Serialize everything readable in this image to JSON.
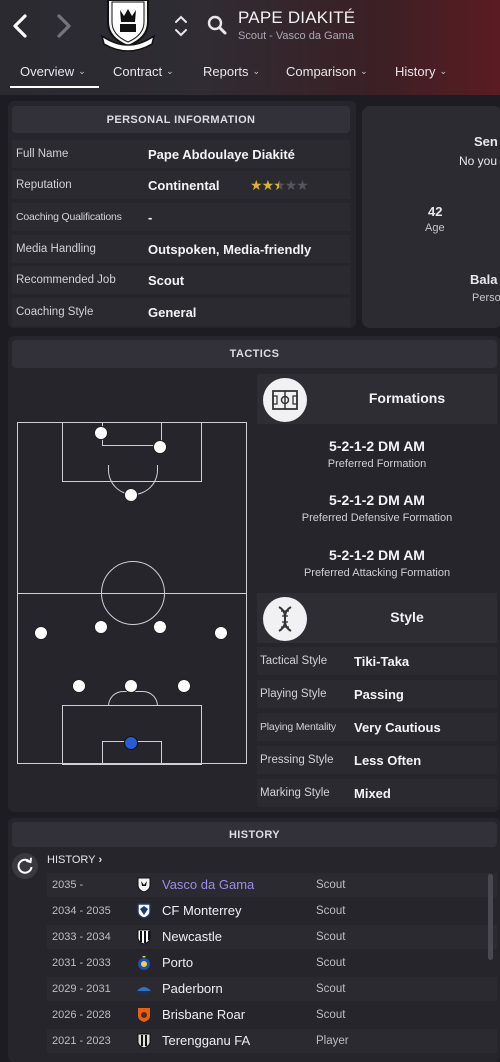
{
  "header": {
    "player_name": "PAPE DIAKITÉ",
    "subtitle": "Scout - Vasco da Gama"
  },
  "tabs": [
    {
      "label": "Overview",
      "active": true
    },
    {
      "label": "Contract"
    },
    {
      "label": "Reports"
    },
    {
      "label": "Comparison"
    },
    {
      "label": "History"
    }
  ],
  "personal": {
    "heading": "PERSONAL INFORMATION",
    "rows": [
      {
        "label": "Full Name",
        "value": "Pape Abdoulaye Diakité"
      },
      {
        "label": "Reputation",
        "value": "Continental",
        "stars": 2.5,
        "stars_max": 5
      },
      {
        "label": "Coaching Qualifications",
        "value": "-"
      },
      {
        "label": "Media Handling",
        "value": "Outspoken, Media-friendly"
      },
      {
        "label": "Recommended Job",
        "value": "Scout"
      },
      {
        "label": "Coaching Style",
        "value": "General"
      }
    ]
  },
  "side_card": {
    "line1": "Sen",
    "line2": "No you",
    "age_value": "42",
    "age_label": "Age",
    "line3": "Bala",
    "line4": "Perso"
  },
  "tactics": {
    "heading": "TACTICS",
    "formations_title": "Formations",
    "formations": [
      {
        "value": "5-2-1-2 DM AM",
        "label": "Preferred Formation"
      },
      {
        "value": "5-2-1-2 DM AM",
        "label": "Preferred Defensive Formation"
      },
      {
        "value": "5-2-1-2 DM AM",
        "label": "Preferred Attacking Formation"
      }
    ],
    "style_title": "Style",
    "style_rows": [
      {
        "label": "Tactical Style",
        "value": "Tiki-Taka"
      },
      {
        "label": "Playing Style",
        "value": "Passing"
      },
      {
        "label": "Playing Mentality",
        "value": "Very Cautious"
      },
      {
        "label": "Pressing Style",
        "value": "Less Often"
      },
      {
        "label": "Marking Style",
        "value": "Mixed"
      }
    ]
  },
  "history": {
    "heading": "HISTORY",
    "link_label": "HISTORY",
    "rows": [
      {
        "years": "2035 -",
        "club": "Vasco da Gama",
        "role": "Scout",
        "badge_color": "#1a1a1a"
      },
      {
        "years": "2034 - 2035",
        "club": "CF Monterrey",
        "role": "Scout",
        "badge_color": "#1b3a7a"
      },
      {
        "years": "2033 - 2034",
        "club": "Newcastle",
        "role": "Scout",
        "badge_color": "#111111"
      },
      {
        "years": "2031 - 2033",
        "club": "Porto",
        "role": "Scout",
        "badge_color": "#1f4fb0"
      },
      {
        "years": "2029 - 2031",
        "club": "Paderborn",
        "role": "Scout",
        "badge_color": "#2a73c9"
      },
      {
        "years": "2026 - 2028",
        "club": "Brisbane Roar",
        "role": "Scout",
        "badge_color": "#e2621c"
      },
      {
        "years": "2021 - 2023",
        "club": "Terengganu FA",
        "role": "Player",
        "badge_color": "#e0e0e0"
      }
    ]
  },
  "colors": {
    "accent_underline": "#ffffff",
    "star_on": "#d8b43a",
    "current_club_link": "#9d8ce8",
    "goalkeeper_dot": "#2a5bd7"
  }
}
